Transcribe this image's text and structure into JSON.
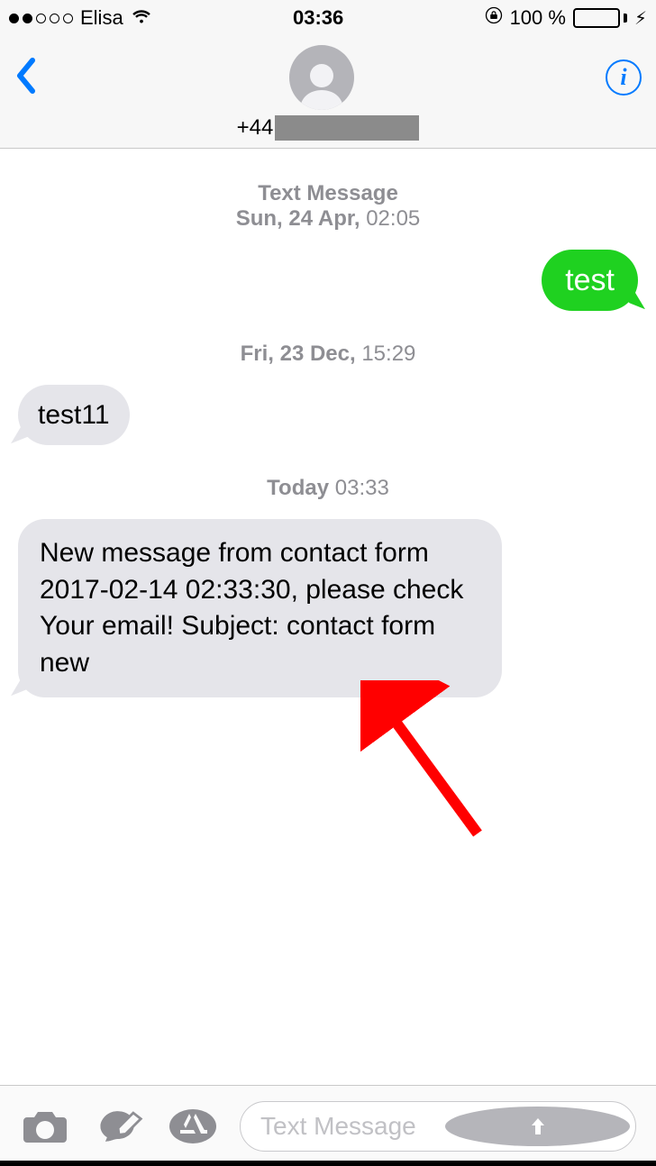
{
  "status": {
    "carrier": "Elisa",
    "time": "03:36",
    "battery_text": "100 %"
  },
  "header": {
    "phone_prefix": "+44"
  },
  "thread": {
    "block1": {
      "label": "Text Message",
      "date_bold": "Sun, 24 Apr,",
      "date_time": " 02:05"
    },
    "msg1": "test",
    "block2": {
      "date_bold": "Fri, 23 Dec,",
      "date_time": " 15:29"
    },
    "msg2": "test11",
    "block3": {
      "date_bold": "Today",
      "date_time": " 03:33"
    },
    "msg3": "New message from contact form 2017-02-14 02:33:30, please check Your email! Subject: contact form new"
  },
  "compose": {
    "placeholder": "Text Message"
  }
}
